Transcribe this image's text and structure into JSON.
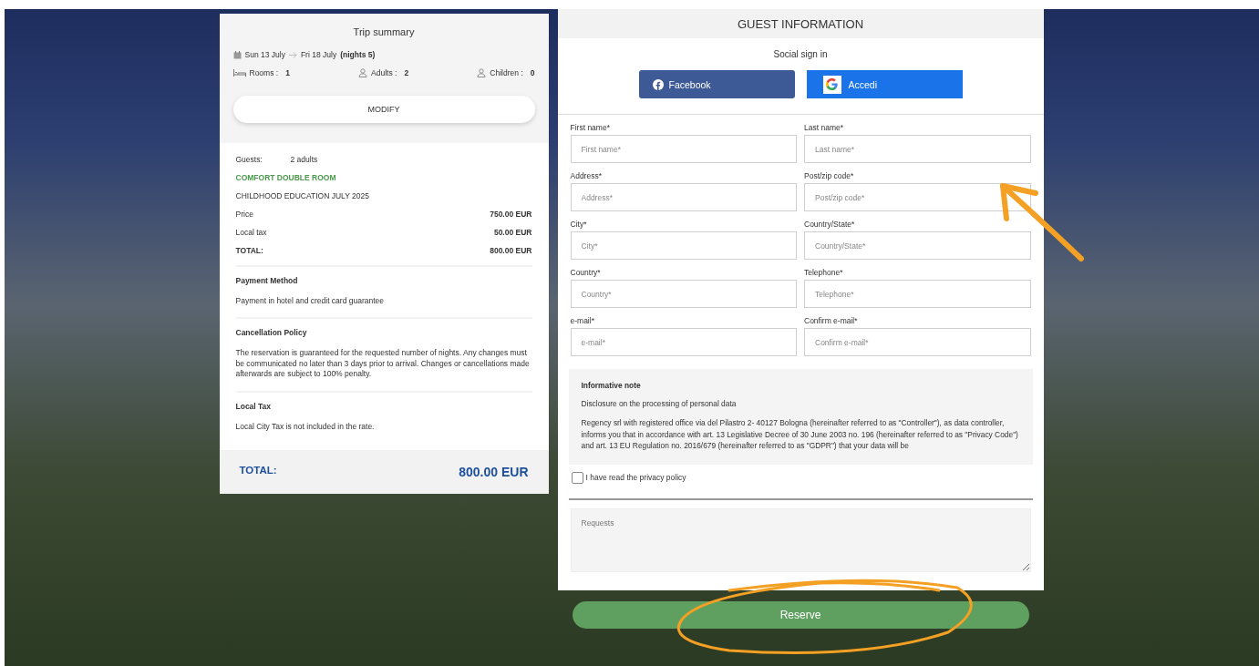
{
  "trip_summary": {
    "title": "Trip summary",
    "check_in": "Sun 13 July",
    "check_out": "Fri 18 July",
    "nights": "(nights 5)",
    "rooms_label": "Rooms :",
    "rooms": "1",
    "adults_label": "Adults :",
    "adults": "2",
    "children_label": "Children :",
    "children": "0",
    "modify_button": "MODIFY"
  },
  "booking": {
    "guests_label": "Guests:",
    "guests": "2 adults",
    "room_name": "COMFORT DOUBLE ROOM",
    "rate_name": "CHILDHOOD EDUCATION JULY 2025",
    "lines": [
      {
        "label": "Price",
        "value": "750.00 EUR",
        "kind": "normal"
      },
      {
        "label": "Local tax",
        "value": "50.00 EUR",
        "kind": "normal"
      },
      {
        "label": "TOTAL:",
        "value": "800.00 EUR",
        "kind": "total"
      }
    ]
  },
  "sections": [
    {
      "title": "Payment Method",
      "text": "Payment in hotel and credit card guarantee"
    },
    {
      "title": "Cancellation Policy",
      "text": "The reservation is guaranteed for the requested number of nights. Any changes must be communicated no later than 3 days prior to arrival. Changes or cancellations made afterwards are subject to 100% penalty."
    },
    {
      "title": "Local Tax",
      "text": "Local City Tax is not included in the rate."
    }
  ],
  "grand_total": {
    "label": "TOTAL:",
    "value": "800.00 EUR"
  },
  "guest_form": {
    "title": "GUEST INFORMATION",
    "social_label": "Social sign in",
    "social_buttons": [
      {
        "kind": "facebook",
        "label": "Facebook"
      },
      {
        "kind": "google",
        "label": "Accedi"
      }
    ],
    "fields": [
      {
        "label": "First name*",
        "placeholder": "First name*"
      },
      {
        "label": "Last name*",
        "placeholder": "Last name*"
      },
      {
        "label": "Address*",
        "placeholder": "Address*"
      },
      {
        "label": "Post/zip code*",
        "placeholder": "Post/zip code*"
      },
      {
        "label": "City*",
        "placeholder": "City*"
      },
      {
        "label": "Country/State*",
        "placeholder": "Country/State*"
      },
      {
        "label": "Country*",
        "placeholder": "Country*"
      },
      {
        "label": "Telephone*",
        "placeholder": "Telephone*"
      },
      {
        "label": "e-mail*",
        "placeholder": "e-mail*"
      },
      {
        "label": "Confirm e-mail*",
        "placeholder": "Confirm e-mail*"
      }
    ],
    "note": {
      "title": "Informative note",
      "paragraphs": [
        "Disclosure on the processing of personal data",
        "Regency srl with registered office via del Pilastro 2- 40127 Bologna (hereinafter referred to as \"Controller\"), as data controller, informs you that in accordance with art. 13 Legislative Decree of 30 June 2003 no. 196 (hereinafter referred to as \"Privacy Code\") and art. 13 EU Regulation no. 2016/679 (hereinafter referred to as \"GDPR\") that your data will be"
      ]
    },
    "privacy_checkbox": {
      "label": "I have read the privacy policy",
      "checked": false
    },
    "requests": {
      "placeholder": "Requests"
    }
  },
  "reserve_button": "Reserve"
}
